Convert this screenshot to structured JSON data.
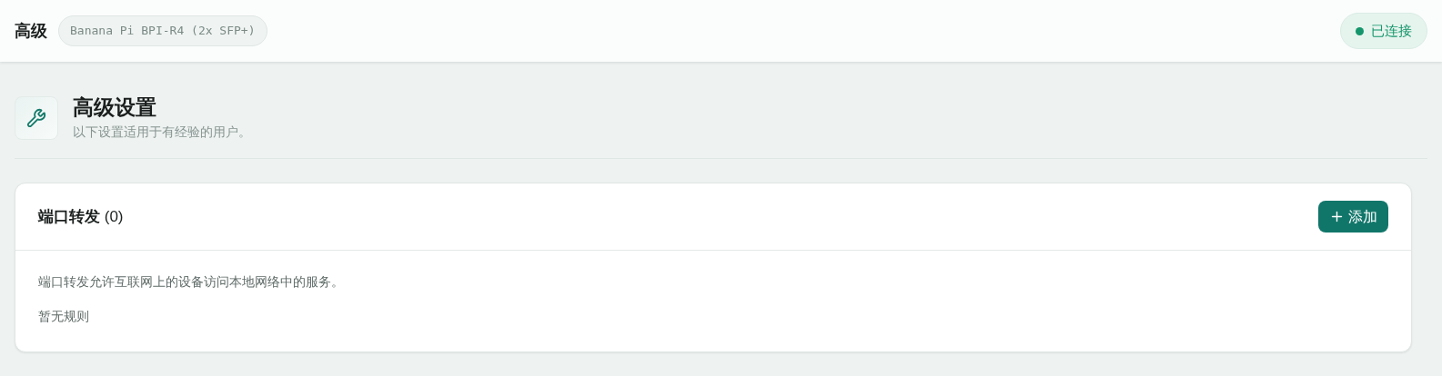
{
  "header": {
    "title": "高级",
    "device": "Banana Pi BPI-R4 (2x SFP+)",
    "status": {
      "label": "已连接",
      "connected": true
    }
  },
  "section": {
    "title": "高级设置",
    "subtitle": "以下设置适用于有经验的用户。"
  },
  "card": {
    "title": "端口转发",
    "count": "(0)",
    "add_button": "添加",
    "description": "端口转发允许互联网上的设备访问本地网络中的服务。",
    "empty_text": "暂无规则"
  }
}
